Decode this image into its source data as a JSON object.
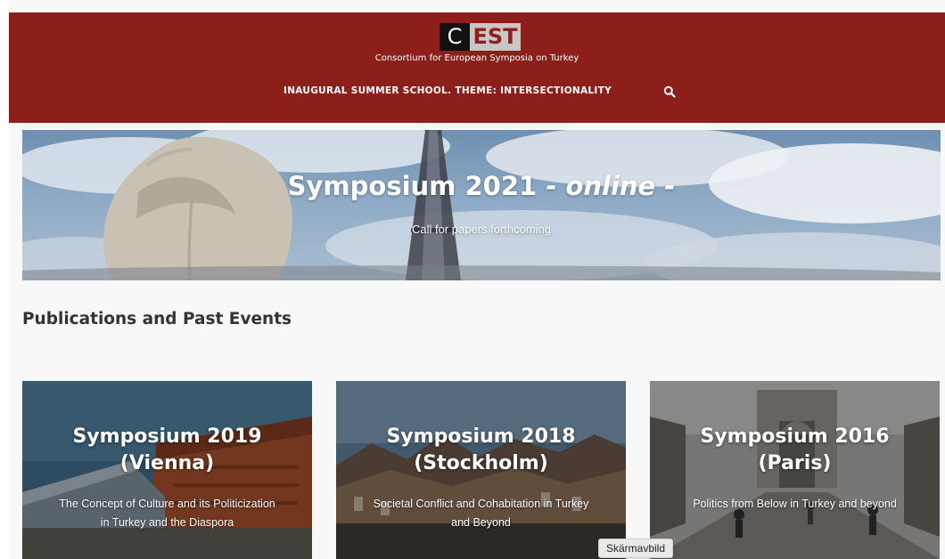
{
  "header": {
    "logo_c": "C",
    "logo_est": "EST",
    "tagline": "Consortium for European Symposia on Turkey",
    "nav_link": "INAUGURAL SUMMER SCHOOL. THEME: INTERSECTIONALITY",
    "search_icon": "search-icon",
    "bg_color": "#8c1f1a"
  },
  "hero": {
    "title_main": "Symposium 2021",
    "title_italic": "- online -",
    "subtitle": "Call for papers forthcoming"
  },
  "section": {
    "title": "Publications and Past Events"
  },
  "cards": [
    {
      "title_line1": "Symposium 2019",
      "title_line2": "(Vienna)",
      "desc_line1": "The Concept of Culture and its Politicization",
      "desc_line2": "in Turkey and the Diaspora"
    },
    {
      "title_line1": "Symposium 2018",
      "title_line2": "(Stockholm)",
      "desc_line1": "Societal Conflict and Cohabitation in Turkey",
      "desc_line2": "and Beyond"
    },
    {
      "title_line1": "Symposium 2016",
      "title_line2": "(Paris)",
      "desc_line1": "Politics from Below in Turkey and beyond",
      "desc_line2": ""
    }
  ],
  "tooltip": {
    "label": "Skärmavbild"
  }
}
